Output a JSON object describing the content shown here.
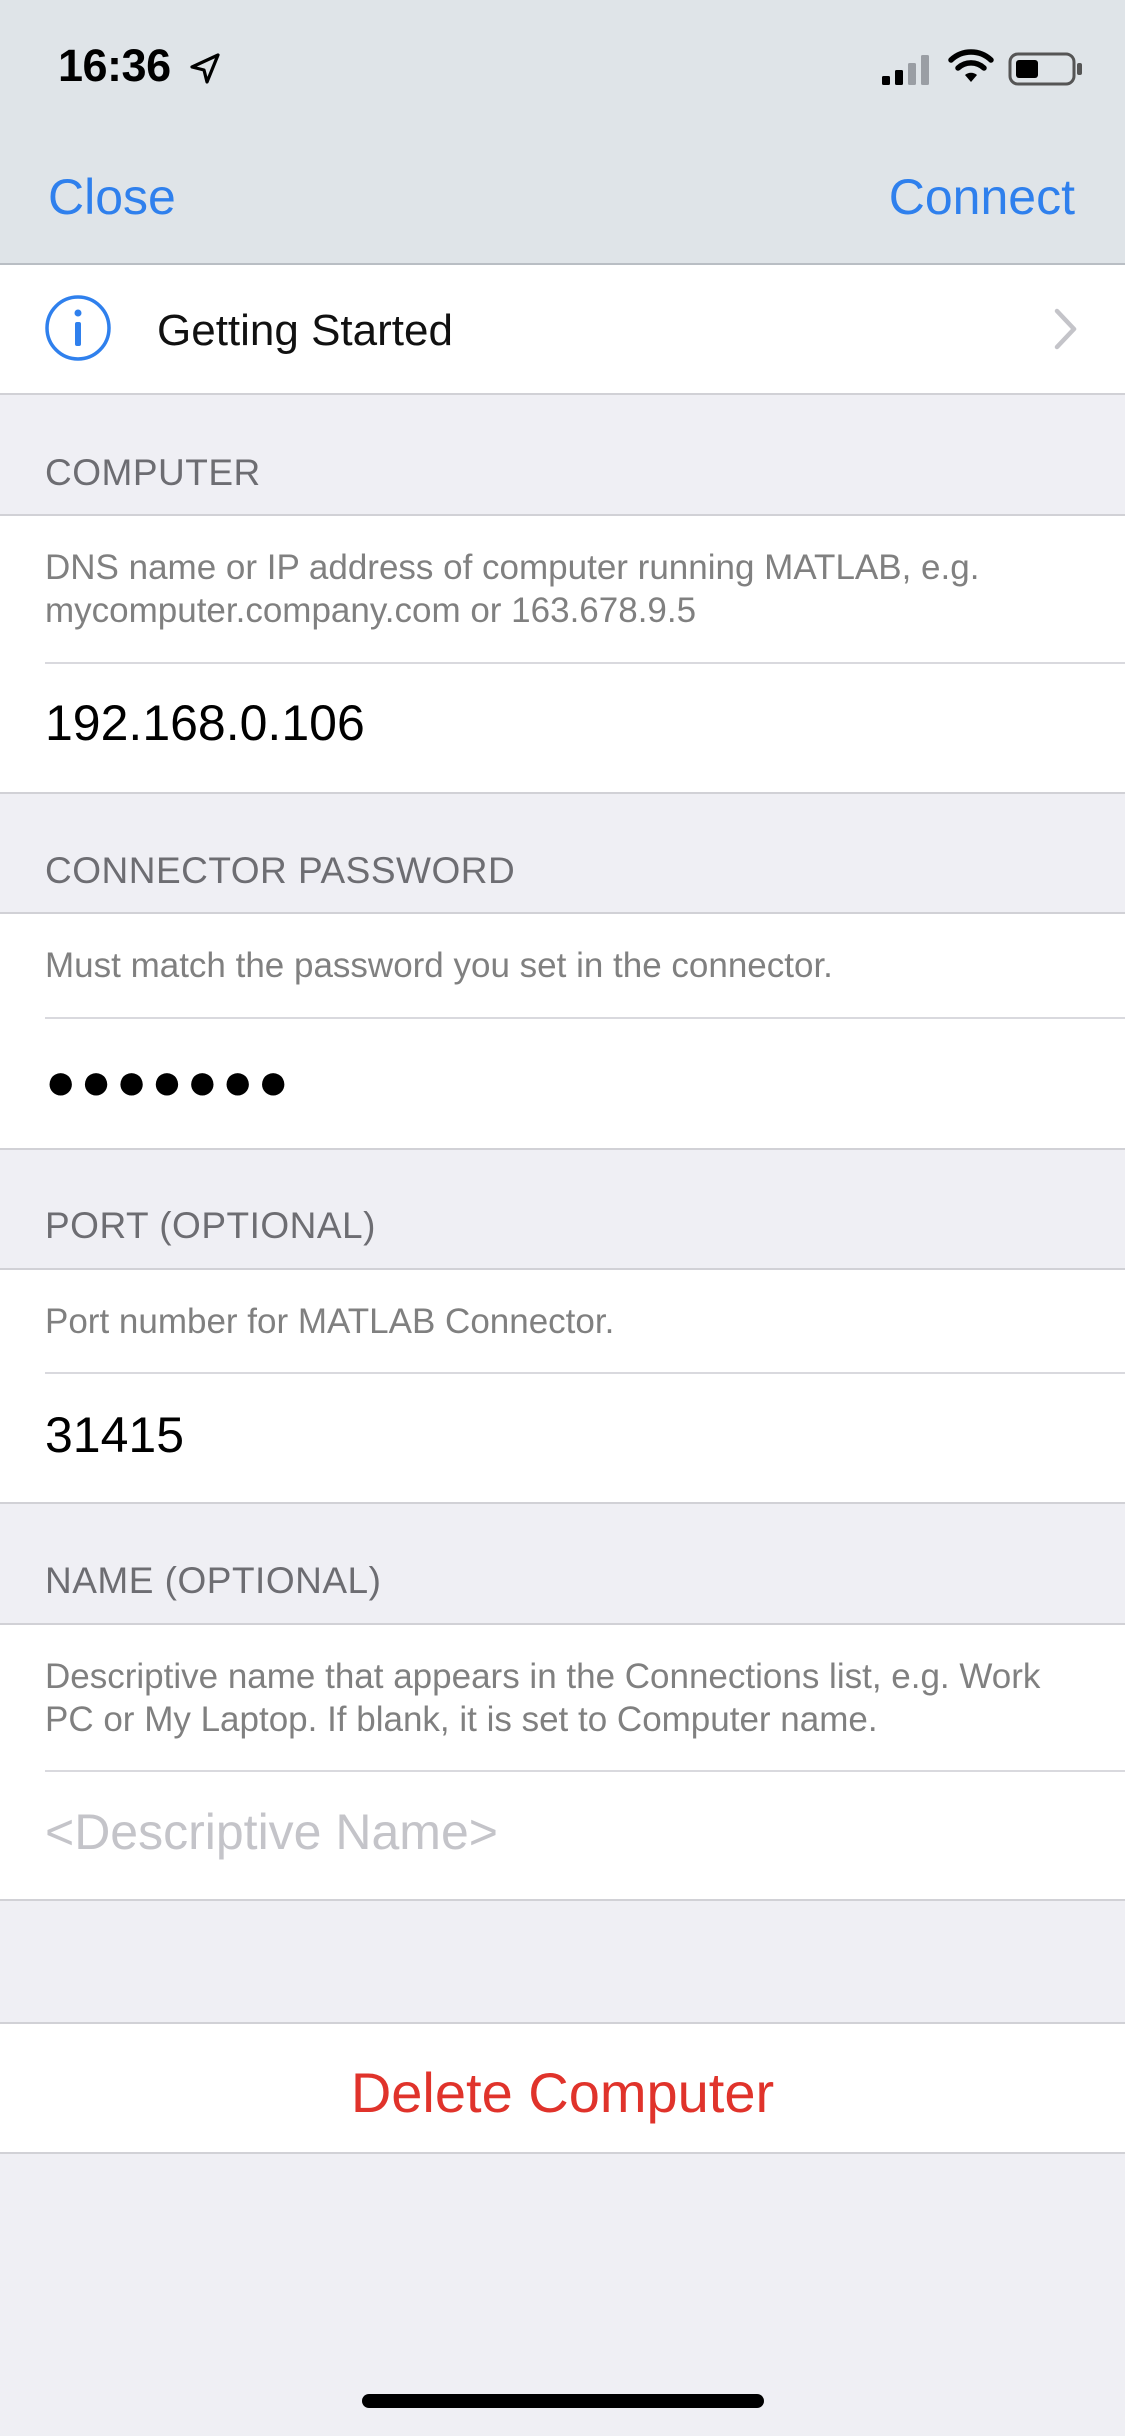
{
  "status_bar": {
    "time": "16:36",
    "icons": [
      "location-arrow-icon",
      "cellular-signal-icon",
      "wifi-icon",
      "battery-icon"
    ]
  },
  "nav": {
    "close_label": "Close",
    "connect_label": "Connect"
  },
  "getting_started": {
    "label": "Getting Started",
    "icon": "info-icon"
  },
  "sections": {
    "computer": {
      "header": "COMPUTER",
      "hint": "DNS name or IP address of computer running MATLAB, e.g. mycomputer.company.com or 163.678.9.5",
      "value": "192.168.0.106"
    },
    "password": {
      "header": "CONNECTOR PASSWORD",
      "hint": "Must match the password you set in the connector.",
      "value": "●●●●●●●"
    },
    "port": {
      "header": "PORT (OPTIONAL)",
      "hint": "Port number for MATLAB Connector.",
      "value": "31415"
    },
    "name": {
      "header": "NAME (OPTIONAL)",
      "hint": "Descriptive name that appears in the Connections list, e.g. Work PC or My Laptop. If blank, it is set to Computer name.",
      "placeholder": "<Descriptive Name>"
    }
  },
  "delete_label": "Delete Computer",
  "colors": {
    "accent": "#2f80ed",
    "destructive": "#e0332b",
    "background": "#efeff4",
    "nav_bar": "#dfe4e8"
  }
}
